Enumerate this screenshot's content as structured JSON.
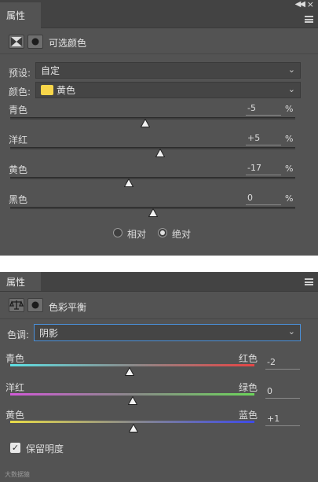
{
  "panel1": {
    "tab_label": "属性",
    "title": "可选颜色",
    "preset_label": "预设:",
    "preset_value": "自定",
    "color_label": "颜色:",
    "color_value": "黄色",
    "sliders": [
      {
        "label": "青色",
        "value": "-5",
        "unit": "%",
        "amount": -5
      },
      {
        "label": "洋红",
        "value": "+5",
        "unit": "%",
        "amount": 5
      },
      {
        "label": "黄色",
        "value": "-17",
        "unit": "%",
        "amount": -17
      },
      {
        "label": "黑色",
        "value": "0",
        "unit": "%",
        "amount": 0
      }
    ],
    "radio_relative": "相对",
    "radio_absolute": "绝对",
    "radio_selected": "绝对",
    "swatch_color": "#f8d64a"
  },
  "panel2": {
    "tab_label": "属性",
    "title": "色彩平衡",
    "tone_label": "色调:",
    "tone_value": "阴影",
    "sliders": [
      {
        "left": "青色",
        "right": "红色",
        "value": "-2",
        "amount": -2
      },
      {
        "left": "洋红",
        "right": "绿色",
        "value": "0",
        "amount": 0
      },
      {
        "left": "黄色",
        "right": "蓝色",
        "value": "+1",
        "amount": 1
      }
    ],
    "preserve_label": "保留明度",
    "preserve_checked": true,
    "focus_color": "#4a90d9"
  },
  "watermark": "大数据猿"
}
